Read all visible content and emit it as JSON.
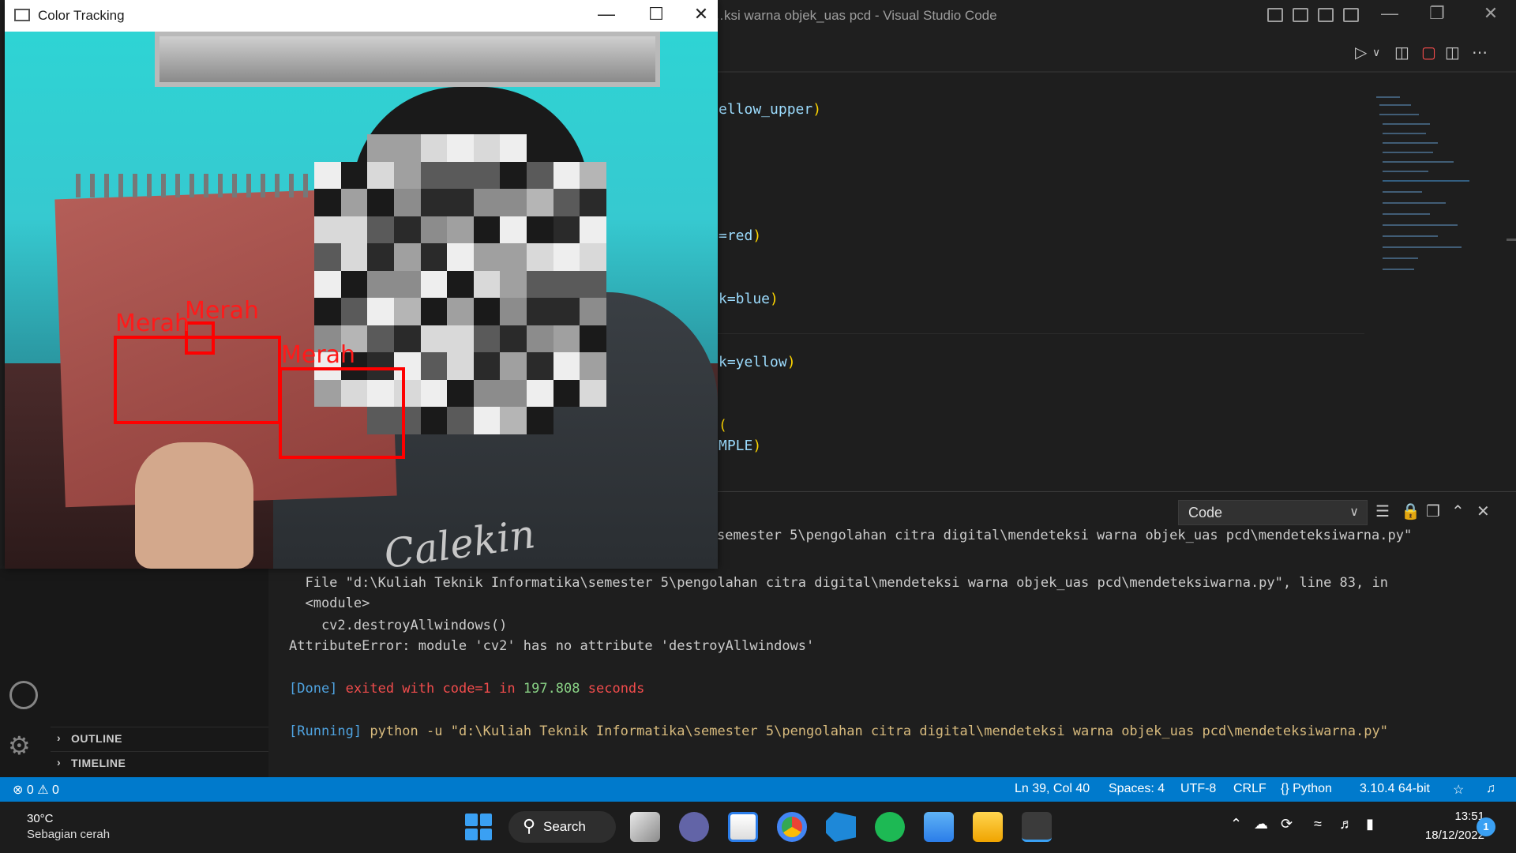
{
  "vscode": {
    "window_title": "…ksi warna objek_uas pcd - Visual Studio Code",
    "code_lines": [
      {
        "pre": "ellow_upper",
        "post": ")"
      },
      {
        "pre": "=red",
        "post": ")"
      },
      {
        "pre": "k=blue",
        "post": ")"
      },
      {
        "pre": "k=yellow",
        "post": ")"
      },
      {
        "pre": "",
        "post": "("
      },
      {
        "pre": "MPLE",
        "post": ")"
      }
    ],
    "panel": {
      "output_channel": "Code"
    },
    "terminal": {
      "line_path_top": "semester 5\\pengolahan citra digital\\mendeteksi warna objek_uas pcd\\mendeteksiwarna.py\"",
      "line_file": "  File \"d:\\Kuliah Teknik Informatika\\semester 5\\pengolahan citra digital\\mendeteksi warna objek_uas pcd\\mendeteksiwarna.py\", line 83, in",
      "line_module": "  <module>",
      "line_call": "    cv2.destroyAllwindows()",
      "line_error": "AttributeError: module 'cv2' has no attribute 'destroyAllwindows'",
      "done_tag": "[Done]",
      "done_text_a": " exited with ",
      "done_code": "code=1",
      "done_text_b": " in ",
      "done_secs": "197.808",
      "done_text_c": " seconds",
      "running_tag": "[Running]",
      "running_cmd": " python -u \"d:\\Kuliah Teknik Informatika\\semester 5\\pengolahan citra digital\\mendeteksi warna objek_uas pcd\\mendeteksiwarna.py\""
    },
    "sidebar": {
      "outline_label": "OUTLINE",
      "timeline_label": "TIMELINE"
    },
    "statusbar": {
      "errors": "0",
      "warnings": "0",
      "cursor": "Ln 39, Col 40",
      "spaces": "Spaces: 4",
      "encoding": "UTF-8",
      "eol": "CRLF",
      "language": "Python",
      "interpreter": "3.10.4 64-bit"
    }
  },
  "color_tracking": {
    "title": "Color Tracking",
    "labels": [
      "Merah",
      "Merah",
      "Merah"
    ],
    "shirt_text": "Calekin"
  },
  "taskbar": {
    "weather_temp": "30°C",
    "weather_desc": "Sebagian cerah",
    "search_label": "Search",
    "time": "13:51",
    "date": "18/12/2022",
    "notifications": "1"
  },
  "colors": {
    "statusbar": "#007acc",
    "detection_box": "#ff0000",
    "terminal_tag": "#4fa3e0"
  }
}
